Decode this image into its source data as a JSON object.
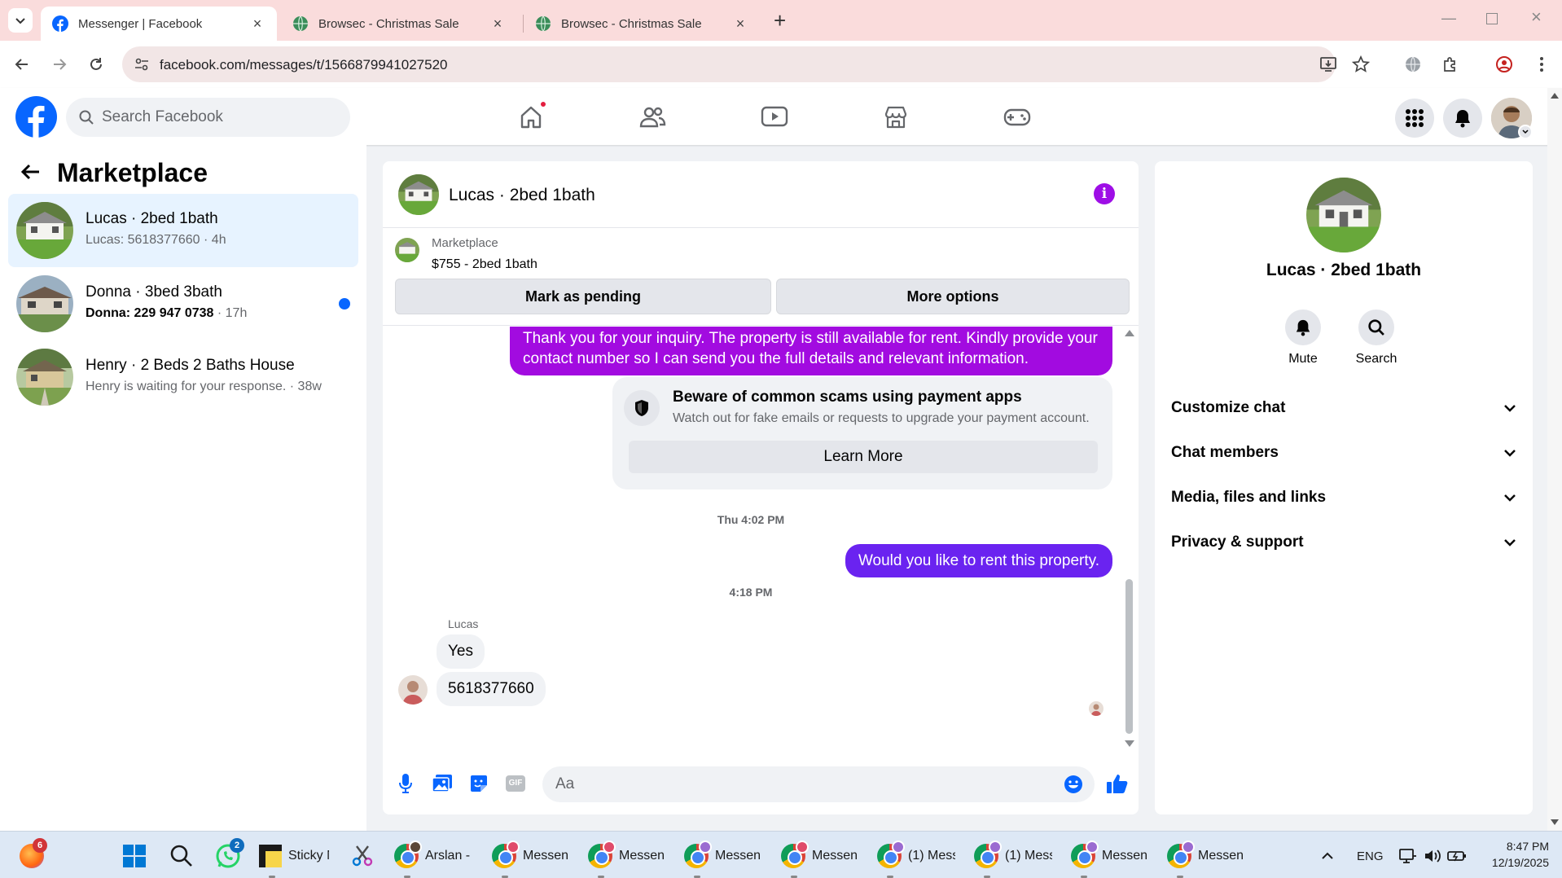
{
  "browser": {
    "tabs": [
      {
        "title": "Messenger | Facebook",
        "active": true
      },
      {
        "title": "Browsec - Christmas Sale",
        "active": false
      },
      {
        "title": "Browsec - Christmas Sale",
        "active": false
      }
    ],
    "new_tab": "+",
    "url": "facebook.com/messages/t/1566879941027520"
  },
  "fb": {
    "search_placeholder": "Search Facebook"
  },
  "sidebar": {
    "title": "Marketplace",
    "conversations": [
      {
        "name": "Lucas · 2bed 1bath",
        "preview": "Lucas: 5618377660 · 4h",
        "active": true,
        "unread": false
      },
      {
        "name": "Donna · 3bed 3bath",
        "preview_bold": "Donna: 229 947 0738",
        "preview_time": " · 17h",
        "active": false,
        "unread": true
      },
      {
        "name": "Henry · 2 Beds 2 Baths House",
        "preview": "Henry is waiting for your response. · 38w",
        "active": false,
        "unread": false
      }
    ]
  },
  "chat": {
    "title": "Lucas · 2bed 1bath",
    "info_glyph": "i",
    "listing": {
      "label": "Marketplace",
      "price_title": "$755 - 2bed 1bath",
      "mark_pending": "Mark as pending",
      "more_options": "More options"
    },
    "messages": {
      "out1": "Thank you for your inquiry. The property is still available for rent. Kindly provide your contact number so I can send you the full details and relevant information.",
      "scam_title": "Beware of common scams using payment apps",
      "scam_desc": "Watch out for fake emails or requests to upgrade your payment account.",
      "learn_more": "Learn More",
      "ts1": "Thu 4:02 PM",
      "out2": "Would you like to rent this property.",
      "ts2": "4:18 PM",
      "sender": "Lucas",
      "in1": "Yes",
      "in2": "5618377660"
    },
    "composer_placeholder": "Aa",
    "gif_label": "GIF"
  },
  "info": {
    "name": "Lucas · 2bed 1bath",
    "actions": [
      "Mute",
      "Search"
    ],
    "sections": [
      "Customize chat",
      "Chat members",
      "Media, files and links",
      "Privacy & support"
    ]
  },
  "taskbar": {
    "firefox_badge": "6",
    "whatsapp_badge": "2",
    "apps": [
      "Sticky N",
      "Arslan -",
      "Messeng",
      "Messeng",
      "Messeng",
      "Messeng",
      "(1) Mess",
      "(1) Mess",
      "Messeng",
      "Messeng"
    ],
    "lang": "ENG",
    "time": "8:47 PM",
    "date": "12/19/2025"
  },
  "colors": {
    "fb_blue": "#0866ff",
    "outgoing_bubble": "#a20be0",
    "outgoing_bubble_2": "#6a23f0",
    "info_button": "#9e0ee6",
    "tab_bar": "#fadcdc"
  }
}
